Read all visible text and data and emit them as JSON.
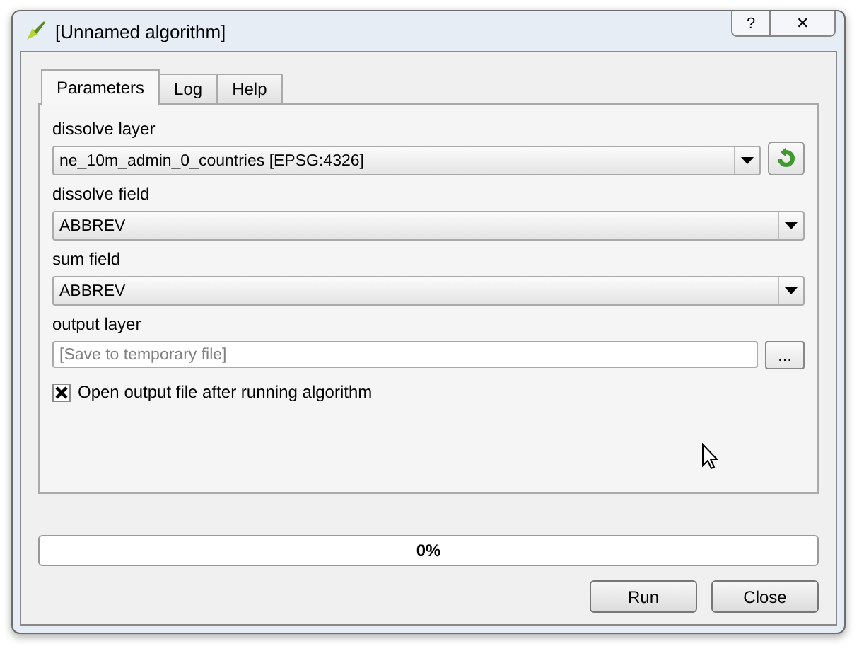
{
  "window": {
    "title": "[Unnamed algorithm]",
    "help_button": "?",
    "close_button": "✕"
  },
  "tabs": [
    {
      "label": "Parameters",
      "selected": true
    },
    {
      "label": "Log",
      "selected": false
    },
    {
      "label": "Help",
      "selected": false
    }
  ],
  "fields": [
    {
      "kind": "layer",
      "label": "dissolve layer",
      "value": "ne_10m_admin_0_countries [EPSG:4326]"
    },
    {
      "kind": "combo",
      "label": "dissolve field",
      "value": "ABBREV"
    },
    {
      "kind": "combo",
      "label": "sum field",
      "value": "ABBREV"
    },
    {
      "kind": "file",
      "label": "output layer",
      "placeholder": "[Save to temporary file]",
      "browse": "..."
    }
  ],
  "open_output": {
    "label": "Open output file after running algorithm",
    "checked": true
  },
  "progress": {
    "level": 0,
    "text": "0%"
  },
  "buttons": [
    "Run",
    "Close"
  ]
}
